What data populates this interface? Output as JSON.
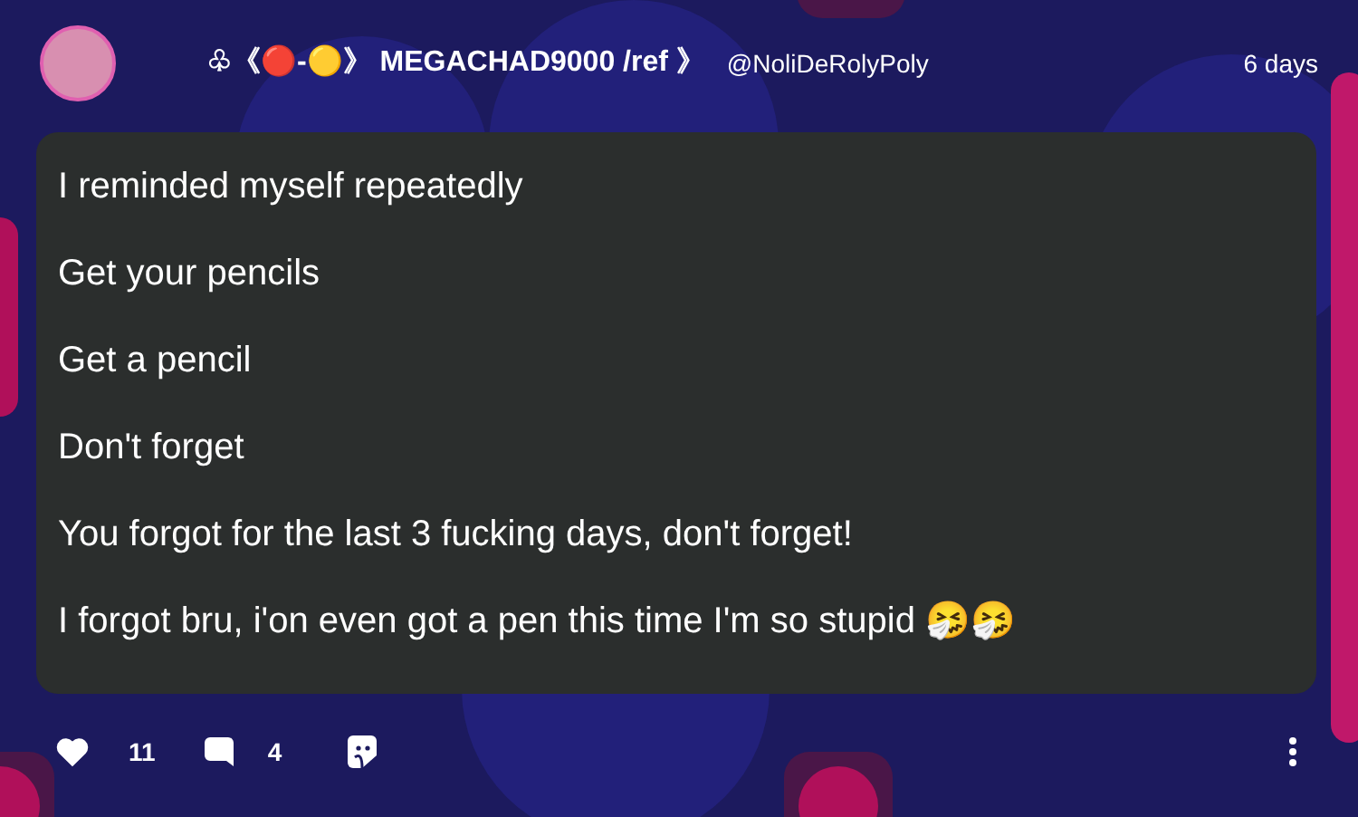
{
  "post": {
    "author": "♧《🔴-🟡》 MEGACHAD9000 /ref 》",
    "handle": "@NoliDeRolyPoly",
    "time": "6 days",
    "paragraphs": [
      "I reminded myself repeatedly",
      "Get your pencils",
      "Get a pencil",
      "Don't forget",
      "You forgot for the last 3 fucking days, don't forget!",
      "I forgot bru, i'on even got a pen this time I'm so stupid 🤧🤧"
    ],
    "likes": "11",
    "comments": "4"
  }
}
